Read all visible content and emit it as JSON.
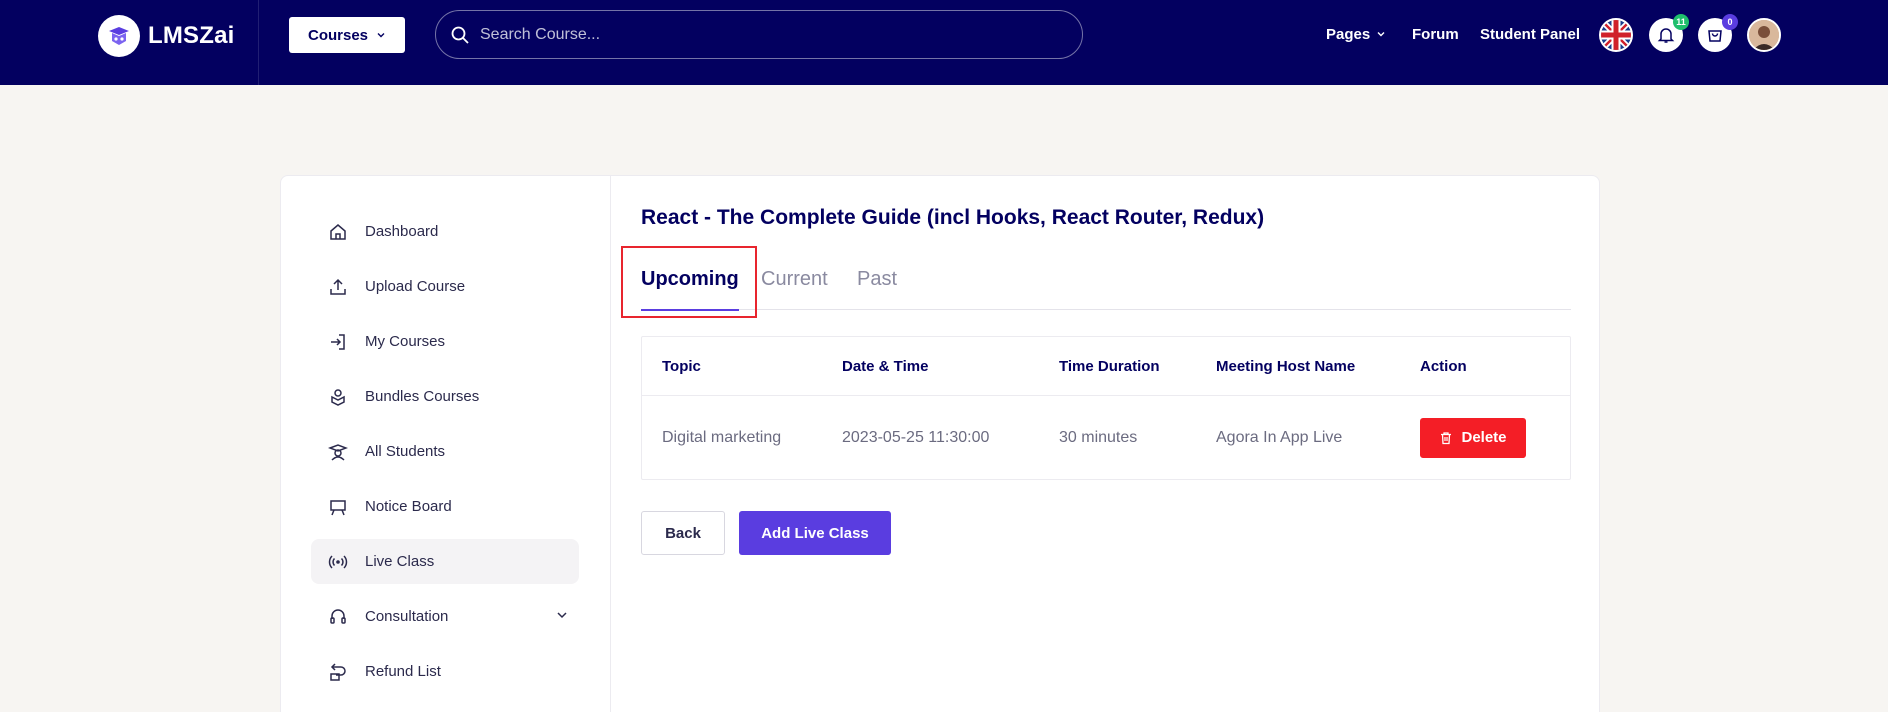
{
  "header": {
    "brand": "LMSZai",
    "courses_label": "Courses",
    "search_placeholder": "Search Course...",
    "nav": [
      "Pages",
      "Forum",
      "Student Panel"
    ],
    "notification_count": "11",
    "cart_count": "0"
  },
  "sidebar": {
    "items": [
      {
        "label": "Dashboard",
        "icon": "home-icon"
      },
      {
        "label": "Upload Course",
        "icon": "upload-icon"
      },
      {
        "label": "My Courses",
        "icon": "login-icon"
      },
      {
        "label": "Bundles Courses",
        "icon": "bundle-icon"
      },
      {
        "label": "All Students",
        "icon": "student-icon"
      },
      {
        "label": "Notice Board",
        "icon": "board-icon"
      },
      {
        "label": "Live Class",
        "icon": "broadcast-icon",
        "active": true
      },
      {
        "label": "Consultation",
        "icon": "headset-icon"
      },
      {
        "label": "Refund List",
        "icon": "refund-icon"
      }
    ]
  },
  "main": {
    "course_title": "React - The Complete Guide (incl Hooks, React Router, Redux)",
    "tabs": [
      "Upcoming",
      "Current",
      "Past"
    ],
    "active_tab": "Upcoming",
    "table": {
      "headers": [
        "Topic",
        "Date & Time",
        "Time Duration",
        "Meeting Host Name",
        "Action"
      ],
      "rows": [
        {
          "topic": "Digital marketing",
          "datetime": "2023-05-25 11:30:00",
          "duration": "30 minutes",
          "host": "Agora In App Live",
          "action": "Delete"
        }
      ]
    },
    "back_label": "Back",
    "add_label": "Add Live Class"
  },
  "colors": {
    "header_bg": "#030060",
    "accent": "#5a3de0",
    "danger": "#f41e26",
    "highlight": "#e8252e"
  }
}
